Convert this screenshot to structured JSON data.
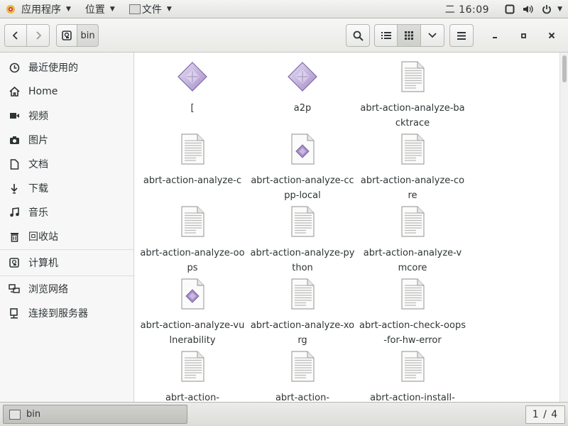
{
  "topbar": {
    "applications": "应用程序",
    "places": "位置",
    "files_app": "文件",
    "clock": "二 16:09"
  },
  "header": {
    "breadcrumb": "bin"
  },
  "sidebar": {
    "items": [
      {
        "label": "最近使用的",
        "icon": "clock-icon"
      },
      {
        "label": "Home",
        "icon": "home-icon"
      },
      {
        "label": "视频",
        "icon": "video-icon"
      },
      {
        "label": "图片",
        "icon": "camera-icon"
      },
      {
        "label": "文档",
        "icon": "document-icon"
      },
      {
        "label": "下载",
        "icon": "download-icon"
      },
      {
        "label": "音乐",
        "icon": "music-icon"
      },
      {
        "label": "回收站",
        "icon": "trash-icon"
      },
      {
        "label": "计算机",
        "icon": "computer-icon"
      },
      {
        "label": "浏览网络",
        "icon": "network-icon"
      },
      {
        "label": "连接到服务器",
        "icon": "server-icon"
      }
    ]
  },
  "files": [
    {
      "name": "[",
      "type": "executable"
    },
    {
      "name": "a2p",
      "type": "executable"
    },
    {
      "name": "abrt-action-analyze-backtrace",
      "type": "text"
    },
    {
      "name": "abrt-action-analyze-c",
      "type": "text"
    },
    {
      "name": "abrt-action-analyze-ccpp-local",
      "type": "script"
    },
    {
      "name": "abrt-action-analyze-core",
      "type": "text"
    },
    {
      "name": "abrt-action-analyze-oops",
      "type": "text"
    },
    {
      "name": "abrt-action-analyze-python",
      "type": "text"
    },
    {
      "name": "abrt-action-analyze-vmcore",
      "type": "text"
    },
    {
      "name": "abrt-action-analyze-vulnerability",
      "type": "script"
    },
    {
      "name": "abrt-action-analyze-xorg",
      "type": "text"
    },
    {
      "name": "abrt-action-check-oops-for-hw-error",
      "type": "text"
    },
    {
      "name": "abrt-action-",
      "type": "text"
    },
    {
      "name": "abrt-action-",
      "type": "text"
    },
    {
      "name": "abrt-action-install-",
      "type": "text"
    }
  ],
  "taskbar": {
    "window_title": "bin",
    "workspace": "1 / 4"
  },
  "colors": {
    "exec_icon": "#a48dc8",
    "accent": "#4a90d9"
  }
}
